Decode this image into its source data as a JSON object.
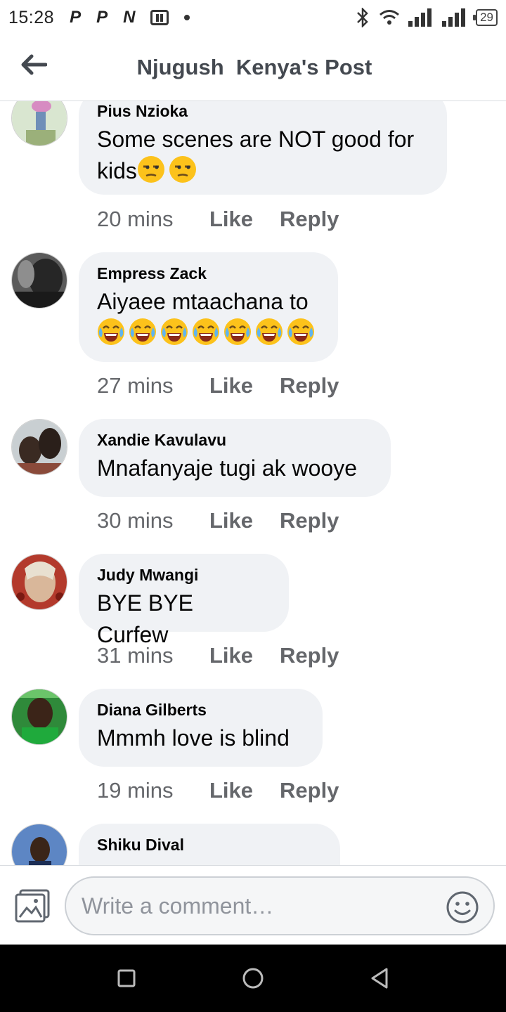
{
  "status_bar": {
    "time": "15:28",
    "notifications": [
      "P",
      "P",
      "N"
    ],
    "battery": "29"
  },
  "header": {
    "title": "Njugush  Kenya's Post"
  },
  "comments": [
    {
      "author": "Pius Nzioka",
      "text": "Some scenes are NOT good for",
      "text2": "kids",
      "emoji": "unamused-face-emoji",
      "time": "20 mins",
      "like": "Like",
      "reply": "Reply"
    },
    {
      "author": "Empress Zack",
      "text": "Aiyaee mtaachana to",
      "emoji": "tears-of-joy-emoji",
      "time": "27 mins",
      "like": "Like",
      "reply": "Reply"
    },
    {
      "author": "Xandie Kavulavu",
      "text": "Mnafanyaje tugi ak wooye",
      "time": "30 mins",
      "like": "Like",
      "reply": "Reply"
    },
    {
      "author": "Judy Mwangi",
      "text": "BYE BYE Curfew",
      "time": "31 mins",
      "like": "Like",
      "reply": "Reply"
    },
    {
      "author": "Diana Gilberts",
      "text": "Mmmh love is blind",
      "time": "19 mins",
      "like": "Like",
      "reply": "Reply"
    },
    {
      "author": "Shiku Dival"
    }
  ],
  "composer": {
    "placeholder": "Write a comment…"
  },
  "colors": {
    "bubble": "#f0f2f5",
    "meta_text": "#65676b",
    "header_text": "#444950"
  }
}
